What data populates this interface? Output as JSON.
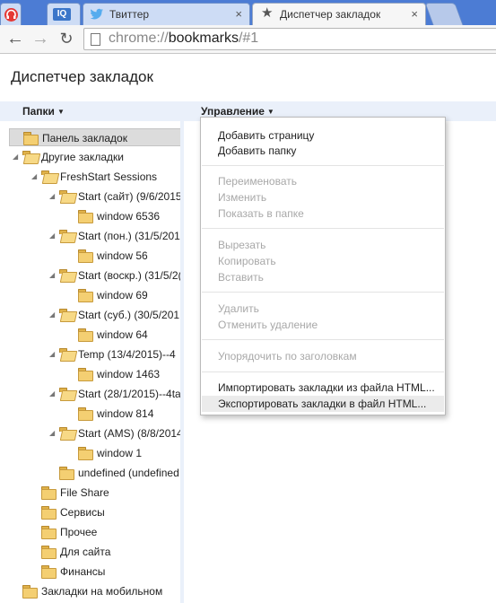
{
  "tabs": [
    {
      "title": "",
      "icon": "headphones-icon"
    },
    {
      "title": "",
      "icon": "iq-icon",
      "icon_text": "IQ"
    },
    {
      "title": "Твиттер",
      "icon": "twitter-bird-icon",
      "close": "×"
    },
    {
      "title": "Диспетчер закладок",
      "icon": "star-icon",
      "close": "×"
    }
  ],
  "toolbar": {
    "url_scheme": "chrome://",
    "url_host": "bookmarks",
    "url_path": "/#1"
  },
  "page": {
    "title": "Диспетчер закладок"
  },
  "columns": {
    "folders": "Папки",
    "organize": "Управление"
  },
  "tree": {
    "items": [
      {
        "label": "Панель закладок"
      },
      {
        "label": "Другие закладки"
      },
      {
        "label": "FreshStart Sessions"
      },
      {
        "label": "Start (сайт) (9/6/2015"
      },
      {
        "label": "window 6536"
      },
      {
        "label": "Start (пон.) (31/5/201"
      },
      {
        "label": "window 56"
      },
      {
        "label": "Start (воскр.) (31/5/2("
      },
      {
        "label": "window 69"
      },
      {
        "label": "Start (суб.) (30/5/201!"
      },
      {
        "label": "window 64"
      },
      {
        "label": "Temp (13/4/2015)--4"
      },
      {
        "label": "window 1463"
      },
      {
        "label": "Start (28/1/2015)--4ta"
      },
      {
        "label": "window 814"
      },
      {
        "label": "Start (AMS) (8/8/2014"
      },
      {
        "label": "window 1"
      },
      {
        "label": "undefined (undefined"
      },
      {
        "label": "File Share"
      },
      {
        "label": "Сервисы"
      },
      {
        "label": "Прочее"
      },
      {
        "label": "Для сайта"
      },
      {
        "label": "Финансы"
      },
      {
        "label": "Закладки на мобильном"
      }
    ]
  },
  "menu": {
    "items": [
      {
        "label": "Добавить страницу",
        "enabled": true
      },
      {
        "label": "Добавить папку",
        "enabled": true
      },
      {
        "label": "Переименовать",
        "enabled": false
      },
      {
        "label": "Изменить",
        "enabled": false
      },
      {
        "label": "Показать в папке",
        "enabled": false
      },
      {
        "label": "Вырезать",
        "enabled": false
      },
      {
        "label": "Копировать",
        "enabled": false
      },
      {
        "label": "Вставить",
        "enabled": false
      },
      {
        "label": "Удалить",
        "enabled": false
      },
      {
        "label": "Отменить удаление",
        "enabled": false
      },
      {
        "label": "Упорядочить по заголовкам",
        "enabled": false
      },
      {
        "label": "Импортировать закладки из файла HTML...",
        "enabled": true
      },
      {
        "label": "Экспортировать закладки в файл HTML...",
        "enabled": true,
        "hovered": true
      }
    ]
  },
  "colors": {
    "tabstrip": "#4c7cd4",
    "header": "#eaf0fa",
    "twitter": "#55acee",
    "folder": "#f4cf72"
  }
}
